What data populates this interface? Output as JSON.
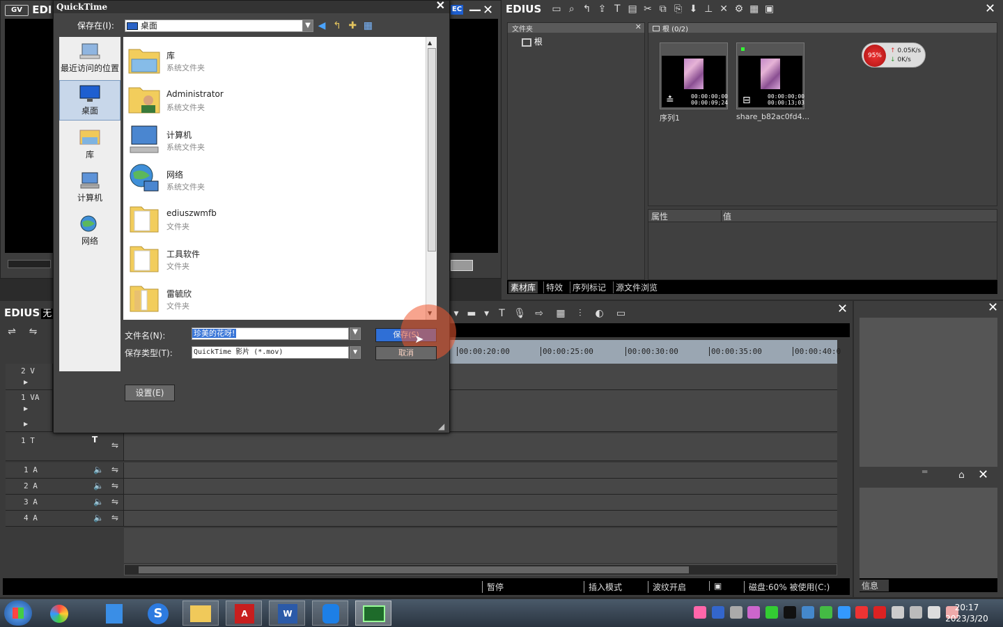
{
  "player": {
    "title": "EDI"
  },
  "bin": {
    "title": "EDIUS",
    "folder_header": "文件夹",
    "root_label": "根",
    "content_header": "根 (0/2)",
    "clips": [
      {
        "name": "序列1",
        "tc_in": "00:00:00;00",
        "tc_out": "00:00:09;24"
      },
      {
        "name": "share_b82ac0fd4...",
        "tc_in": "00:00:00;00",
        "tc_out": "00:00:13;03"
      }
    ],
    "net": {
      "percent": "95%",
      "up": "0.05K/s",
      "down": "0K/s"
    },
    "prop_col1": "属性",
    "prop_col2": "值",
    "tabs": [
      "素材库",
      "特效",
      "序列标记",
      "源文件浏览"
    ]
  },
  "timeline": {
    "title": "EDIUS",
    "title_suffix": "无",
    "ruler": [
      "00:00:20:00",
      "00:00:25:00",
      "00:00:30:00",
      "00:00:35:00",
      "00:00:40:0"
    ],
    "tracks": [
      "2 V",
      "1 VA",
      "1 T",
      "1 A",
      "2 A",
      "3 A",
      "4 A"
    ],
    "status": {
      "pause": "暂停",
      "mode": "插入模式",
      "ripple": "波纹开启",
      "disk": "磁盘:60% 被使用(C:)"
    }
  },
  "info": {
    "tab": "信息"
  },
  "dialog": {
    "title": "QuickTime",
    "save_in_label": "保存在(I):",
    "save_in_value": "桌面",
    "places": [
      "最近访问的位置",
      "桌面",
      "库",
      "计算机",
      "网络"
    ],
    "files": [
      {
        "name": "库",
        "type": "系统文件夹"
      },
      {
        "name": "Administrator",
        "type": "系统文件夹"
      },
      {
        "name": "计算机",
        "type": "系统文件夹"
      },
      {
        "name": "网络",
        "type": "系统文件夹"
      },
      {
        "name": "ediuszwmfb",
        "type": "文件夹"
      },
      {
        "name": "工具软件",
        "type": "文件夹"
      },
      {
        "name": "雷毓欣",
        "type": "文件夹"
      }
    ],
    "filename_label": "文件名(N):",
    "filename_value": "珍美的花呀!",
    "filetype_label": "保存类型(T):",
    "filetype_value": "QuickTime 影片 (*.mov)",
    "save_button": "保存(S)",
    "cancel_button": "取消",
    "settings_button": "设置(E)"
  },
  "taskbar": {
    "time": "20:17",
    "date": "2023/3/20"
  }
}
